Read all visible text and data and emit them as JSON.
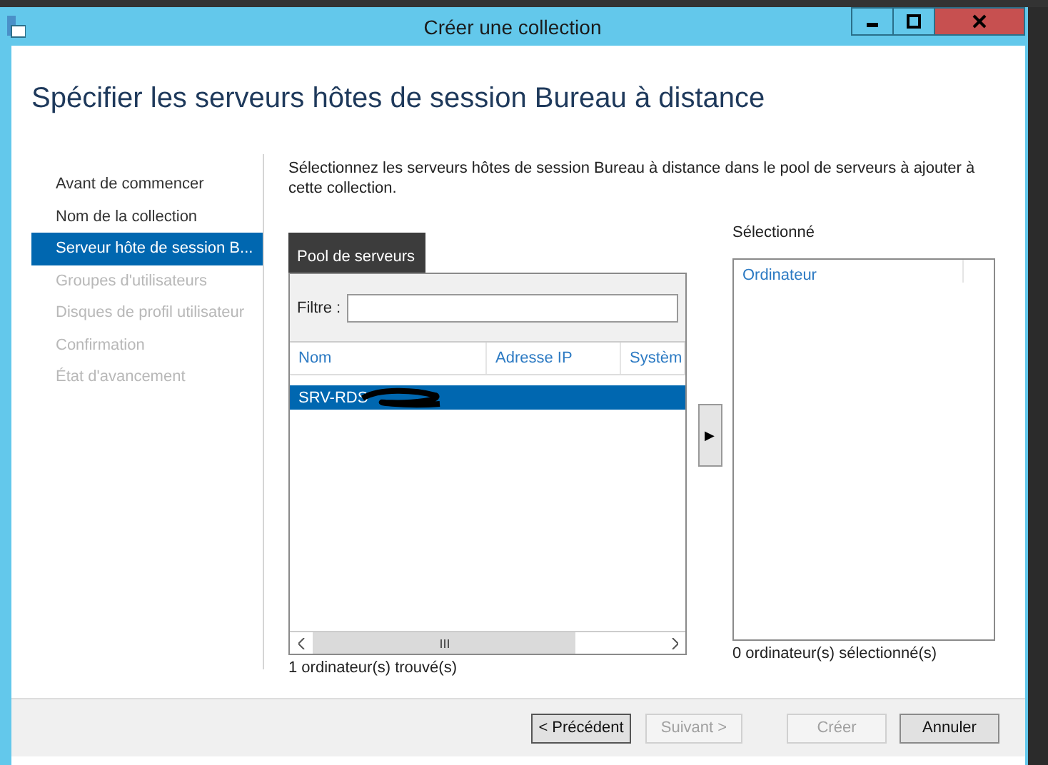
{
  "window": {
    "title": "Créer une collection",
    "controls": [
      {
        "kind": "minimize"
      },
      {
        "kind": "maximize"
      },
      {
        "kind": "close"
      }
    ]
  },
  "heading": "Spécifier les serveurs hôtes de session Bureau à distance",
  "steps": [
    {
      "label": "Avant de commencer",
      "selected": false,
      "disabled": false
    },
    {
      "label": "Nom de la collection",
      "selected": false,
      "disabled": false
    },
    {
      "label": "Serveur hôte de session B...",
      "selected": true,
      "disabled": false
    },
    {
      "label": "Groupes d'utilisateurs",
      "selected": false,
      "disabled": true
    },
    {
      "label": "Disques de profil utilisateur",
      "selected": false,
      "disabled": true
    },
    {
      "label": "Confirmation",
      "selected": false,
      "disabled": true
    },
    {
      "label": "État d'avancement",
      "selected": false,
      "disabled": true
    }
  ],
  "description": "Sélectionnez les serveurs hôtes de session Bureau à distance dans le pool de serveurs à ajouter à cette collection.",
  "pool": {
    "tab": "Pool de serveurs",
    "filter_label": "Filtre :",
    "columns": [
      "Nom",
      "Adresse IP",
      "Systèm"
    ],
    "rows": [
      {
        "name": "SRV-RDS",
        "selected": true,
        "redacted": true
      }
    ],
    "add_button": "▶",
    "count": "1 ordinateur(s) trouvé(s)"
  },
  "selected_panel": {
    "label": "Sélectionné",
    "columns": [
      "Ordinateur"
    ],
    "count": "0 ordinateur(s) sélectionné(s)"
  },
  "buttons": [
    {
      "label": "< Précédent",
      "disabled": false,
      "focused": true
    },
    {
      "label": "Suivant >",
      "disabled": true,
      "focused": false
    },
    {
      "label": "Créer",
      "disabled": true,
      "focused": false
    },
    {
      "label": "Annuler",
      "disabled": false,
      "focused": false
    }
  ]
}
